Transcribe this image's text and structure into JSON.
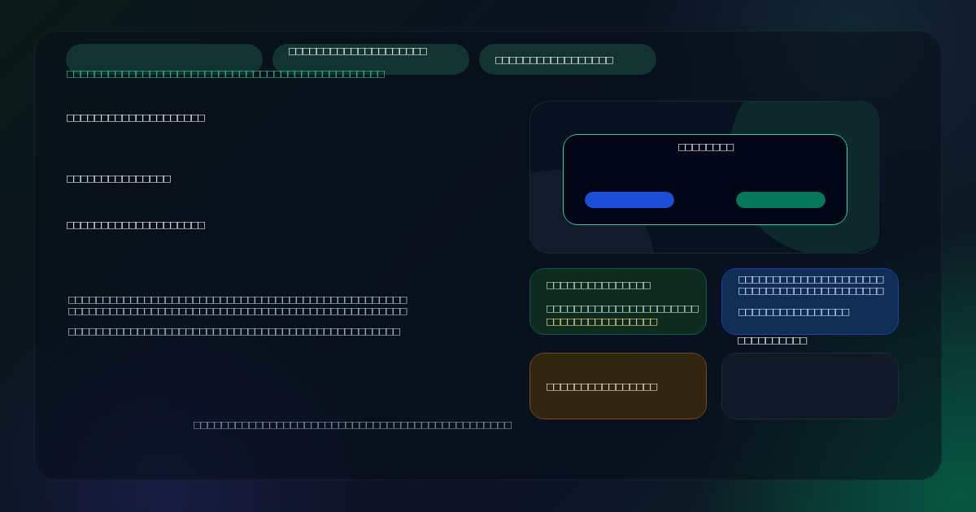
{
  "pills": [
    {
      "kind": "blank"
    },
    {
      "kind": "label",
      "label": "□□□□□□□□□□□□□□□□□□□□"
    },
    {
      "kind": "label",
      "label": "□□□□□□□□□□□□□□□□□"
    }
  ],
  "subtitle": "□□□□□□□□□□□□□□□□□□□□□□□□□□□□□□□□□□□□□□□□□□□□□□",
  "labels": [
    "□□□□□□□□□□□□□□□□□□□□",
    "□□□□□□□□□□□□□□□",
    "□□□□□□□□□□□□□□□□□□□□"
  ],
  "paragraph": [
    "□□□□□□□□□□□□□□□□□□□□□□□□□□□□□□□□□□□□□□□□□□□□□□□□□",
    "□□□□□□□□□□□□□□□□□□□□□□□□□□□□□□□□□□□□□□□□□□□□□□□□□",
    "□□□□□□□□□□□□□□□□□□□□□□□□□□□□□□□□□□□□□□□□□□□□□□□□"
  ],
  "footer": "□□□□□□□□□□□□□□□□□□□□□□□□□□□□□□□□□□□□□□□□□□□□□□",
  "preview": {
    "title": "□□□□□□□□",
    "buttons": [
      {
        "kind": "primary"
      },
      {
        "kind": "success"
      }
    ]
  },
  "cards": [
    {
      "kind": "success",
      "lines": [
        {
          "kind": "plain",
          "text": "□□□□□□□□□□□□□□□"
        },
        {
          "kind": "plain",
          "text": "□□□□□□□□□□□□□□□□□□□□□□"
        },
        {
          "kind": "highlight",
          "text": "□□□□□□□□□□□□□□□□"
        }
      ]
    },
    {
      "kind": "info",
      "lines": [
        {
          "kind": "plain",
          "text": "□□□□□□□□□□□□□□□□□□□□□"
        },
        {
          "kind": "plain",
          "text": "□□□□□□□□□□□□□□□□□□□□□"
        },
        {
          "kind": "plain",
          "text": "□□□□□□□□□□□□□□□□"
        }
      ],
      "note": "□□□□□□□□□□"
    },
    {
      "kind": "warning",
      "lines": [
        {
          "kind": "plain",
          "text": "□□□□□□□□□□□□□□□□"
        }
      ]
    },
    {
      "kind": "empty"
    }
  ]
}
